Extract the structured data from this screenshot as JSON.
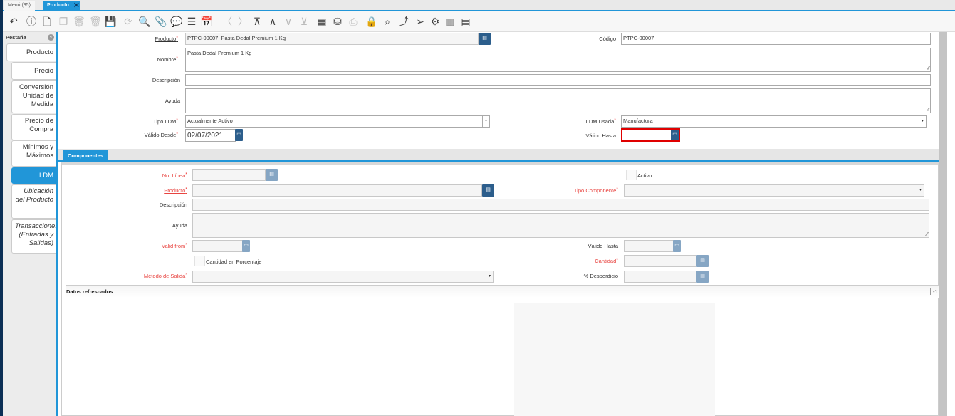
{
  "window_tabs": [
    {
      "label": "Menú (35)"
    },
    {
      "label": "Producto",
      "close": "close-icon"
    }
  ],
  "toolbar": [
    "undo-icon",
    "help-icon",
    "new-icon",
    "copy-icon",
    "delete-icon",
    "delete-selection-icon",
    "save-icon",
    "refresh-icon",
    "search-icon",
    "attach-icon",
    "chat-icon",
    "grid-toggle-icon",
    "calendar-icon",
    "previous-icon",
    "next-icon",
    "first-icon",
    "parent-icon",
    "detail-icon",
    "last-icon",
    "report-icon",
    "archive-icon",
    "print-icon",
    "lock-icon",
    "zoom-across-icon",
    "workflow-icon",
    "send-icon",
    "process-icon",
    "product-info-icon",
    "post-it-icon"
  ],
  "sidebar": {
    "title": "Pestaña",
    "items": [
      {
        "label": "Producto"
      },
      {
        "label": "Precio"
      },
      {
        "label": "Conversión Unidad de Medida"
      },
      {
        "label": "Precio de Compra"
      },
      {
        "label": "Mínimos y Máximos"
      },
      {
        "label": "LDM",
        "active": true
      },
      {
        "label": "Ubicación del Producto"
      },
      {
        "label": "Transacciones (Entradas y Salidas)"
      }
    ]
  },
  "header": {
    "producto_label": "Producto",
    "producto_value": "PTPC-00007_Pasta Dedal Premium 1 Kg",
    "codigo_label": "Código",
    "codigo_value": "PTPC-00007",
    "nombre_label": "Nombre",
    "nombre_value": "Pasta Dedal Premium 1 Kg",
    "descripcion_label": "Descripción",
    "descripcion_value": "",
    "ayuda_label": "Ayuda",
    "ayuda_value": "",
    "tipo_ldm_label": "Tipo LDM",
    "tipo_ldm_value": "Actualmente Activo",
    "ldm_usada_label": "LDM Usada",
    "ldm_usada_value": "Manufactura",
    "valido_desde_label": "Válido Desde",
    "valido_desde_value": "02/07/2021",
    "valido_hasta_label": "Válido Hasta",
    "valido_hasta_value": ""
  },
  "detail_tab": "Componentes",
  "detail": {
    "no_linea_label": "No. Línea",
    "activo_label": "Activo",
    "producto_label": "Producto",
    "tipo_componente_label": "Tipo Componente",
    "descripcion_label": "Descripción",
    "ayuda_label": "Ayuda",
    "valid_from_label": "Valid from",
    "valido_hasta_label": "Válido Hasta",
    "cantidad_porcentaje_label": "Cantidad en Porcentaje",
    "cantidad_label": "Cantidad",
    "metodo_salida_label": "Método de Salida",
    "desperdicio_label": "% Desperdicio"
  },
  "status": {
    "text": "Datos refrescados",
    "count": "-1"
  },
  "colors": {
    "accent": "#2196d8",
    "button": "#2c5e8c",
    "required": "#e8433f",
    "error_border": "#e00000"
  }
}
